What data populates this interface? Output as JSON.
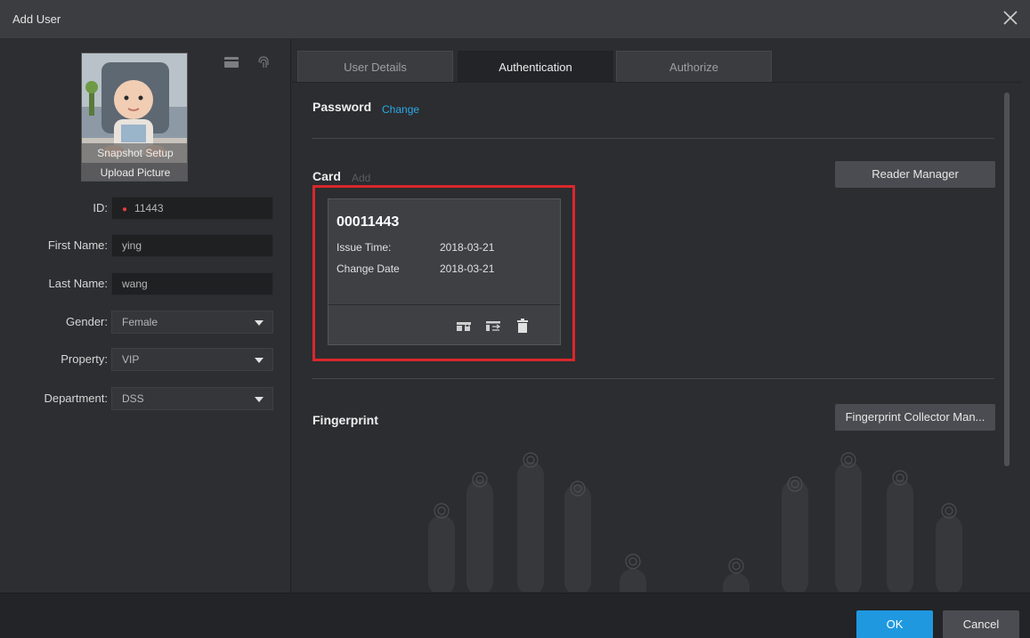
{
  "window": {
    "title": "Add User"
  },
  "photo": {
    "snapshot_label": "Snapshot Setup",
    "upload_label": "Upload Picture"
  },
  "form": {
    "id": {
      "label": "ID:",
      "value": "11443"
    },
    "first_name": {
      "label": "First Name:",
      "value": "ying"
    },
    "last_name": {
      "label": "Last Name:",
      "value": "wang"
    },
    "gender": {
      "label": "Gender:",
      "value": "Female"
    },
    "property": {
      "label": "Property:",
      "value": "VIP"
    },
    "department": {
      "label": "Department:",
      "value": "DSS"
    }
  },
  "tabs": [
    {
      "label": "User Details"
    },
    {
      "label": "Authentication"
    },
    {
      "label": "Authorize"
    }
  ],
  "active_tab": "Authentication",
  "password": {
    "title": "Password",
    "change_label": "Change"
  },
  "card_section": {
    "title": "Card",
    "add_label": "Add",
    "reader_manager_label": "Reader Manager",
    "card": {
      "number": "00011443",
      "issue_time_label": "Issue Time:",
      "issue_time": "2018-03-21",
      "change_date_label": "Change Date",
      "change_date": "2018-03-21"
    }
  },
  "fingerprint": {
    "title": "Fingerprint",
    "collector_label": "Fingerprint Collector Man..."
  },
  "footer": {
    "ok_label": "OK",
    "cancel_label": "Cancel"
  },
  "colors": {
    "accent": "#1f98e0",
    "link": "#2ea9e8",
    "highlight": "#d9272c",
    "required": "#e53b3b"
  }
}
